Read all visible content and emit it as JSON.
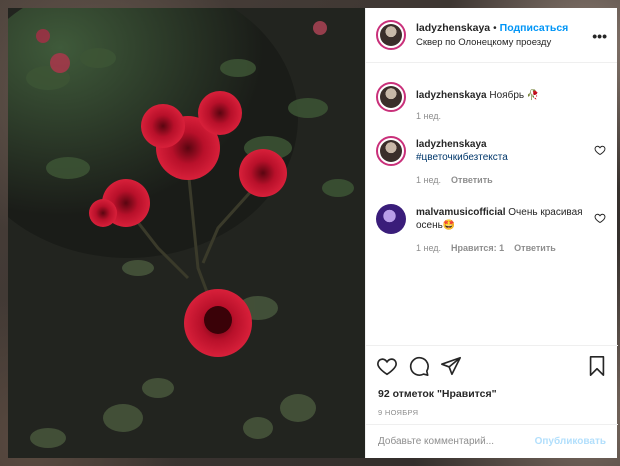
{
  "post": {
    "username": "ladyzhenskaya",
    "separator": "•",
    "follow_label": "Подписаться",
    "location": "Сквер по Олонецкому проезду",
    "more_label": "•••"
  },
  "comments": [
    {
      "username": "ladyzhenskaya",
      "text": "Ноябрь 🥀",
      "time": "1 нед."
    },
    {
      "username": "ladyzhenskaya",
      "text": "#цветочкибезтекста",
      "time": "1 нед.",
      "reply_label": "Ответить"
    },
    {
      "username": "malvamusicofficial",
      "text": "Очень красивая осень🤩",
      "time": "1 нед.",
      "likes_label": "Нравится: 1",
      "reply_label": "Ответить"
    }
  ],
  "actions": {
    "likes": "92 отметок \"Нравится\"",
    "date": "9 НОЯБРЯ"
  },
  "add_comment": {
    "placeholder": "Добавьте комментарий...",
    "publish_label": "Опубликовать"
  },
  "colors": {
    "accent": "#0095f6",
    "publish_disabled": "#b2dffc",
    "story_ring": "#c9307a",
    "hashtag": "#00376b"
  },
  "icons": [
    "heart-icon",
    "comment-icon",
    "share-icon",
    "bookmark-icon",
    "more-icon",
    "like-comment-icon"
  ]
}
